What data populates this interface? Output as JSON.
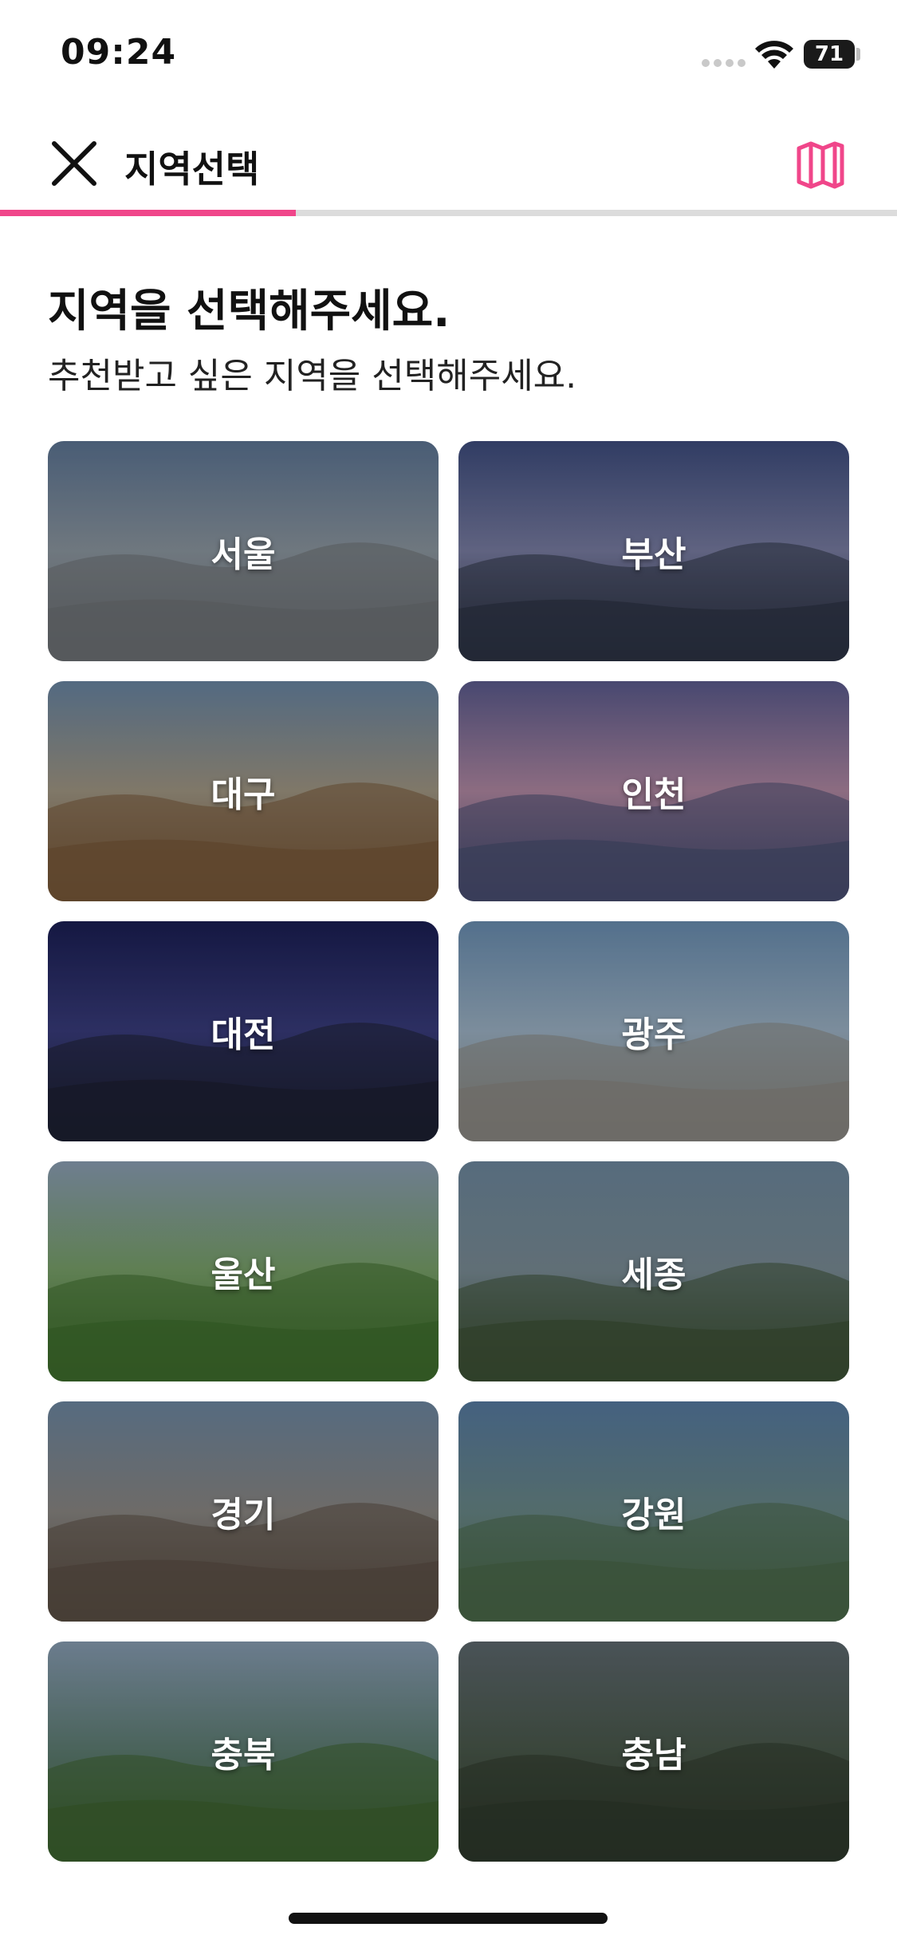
{
  "status": {
    "time": "09:24",
    "battery": "71"
  },
  "header": {
    "title": "지역선택",
    "progress_percent": 33
  },
  "intro": {
    "heading": "지역을 선택해주세요.",
    "subheading": "추천받고 싶은 지역을 선택해주세요."
  },
  "regions": [
    {
      "label": "서울",
      "palette": [
        "#5e7797",
        "#8f9aa3",
        "#6f7377"
      ]
    },
    {
      "label": "부산",
      "palette": [
        "#3f4e80",
        "#7b7fa5",
        "#2e3445"
      ]
    },
    {
      "label": "대구",
      "palette": [
        "#6b88a6",
        "#a49a86",
        "#7a5a3a"
      ]
    },
    {
      "label": "인천",
      "palette": [
        "#5d5d90",
        "#b48ba6",
        "#4a4f72"
      ]
    },
    {
      "label": "대전",
      "palette": [
        "#1b1f55",
        "#3a3d7e",
        "#1d2033"
      ]
    },
    {
      "label": "광주",
      "palette": [
        "#6b90b4",
        "#9fb5c8",
        "#8c8a84"
      ]
    },
    {
      "label": "울산",
      "palette": [
        "#8ea2b8",
        "#7aa36a",
        "#3f6f2e"
      ]
    },
    {
      "label": "세종",
      "palette": [
        "#6f8aa0",
        "#7c8f98",
        "#3e5236"
      ]
    },
    {
      "label": "경기",
      "palette": [
        "#6f89a4",
        "#8d8a86",
        "#5c5046"
      ]
    },
    {
      "label": "강원",
      "palette": [
        "#587da4",
        "#6b8a8a",
        "#4b6a4a"
      ]
    },
    {
      "label": "충북",
      "palette": [
        "#8aa0b6",
        "#5f7f74",
        "#3e6430"
      ]
    },
    {
      "label": "충남",
      "palette": [
        "#5f6a70",
        "#4b5a4c",
        "#2f3a2c"
      ]
    }
  ]
}
